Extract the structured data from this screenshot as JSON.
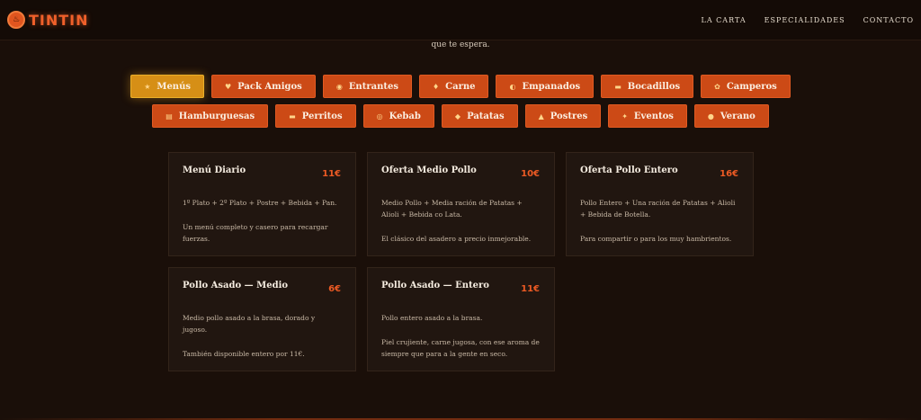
{
  "brand": {
    "name": "TINTIN",
    "logo_icon": "chicken-logo-icon"
  },
  "nav": {
    "items": [
      "LA CARTA",
      "ESPECIALIDADES",
      "CONTACTO"
    ]
  },
  "intro": {
    "text": "que te espera."
  },
  "categories": {
    "row1": [
      {
        "icon": "★",
        "label": "Menús",
        "active": true
      },
      {
        "icon": "♥",
        "label": "Pack Amigos"
      },
      {
        "icon": "◉",
        "label": "Entrantes"
      },
      {
        "icon": "♦",
        "label": "Carne"
      },
      {
        "icon": "◐",
        "label": "Empanados"
      },
      {
        "icon": "▬",
        "label": "Bocadillos"
      },
      {
        "icon": "✿",
        "label": "Camperos"
      }
    ],
    "row2": [
      {
        "icon": "▤",
        "label": "Hamburguesas"
      },
      {
        "icon": "▬",
        "label": "Perritos"
      },
      {
        "icon": "◎",
        "label": "Kebab"
      },
      {
        "icon": "◆",
        "label": "Patatas"
      },
      {
        "icon": "▲",
        "label": "Postres"
      },
      {
        "icon": "✦",
        "label": "Eventos"
      },
      {
        "icon": "●",
        "label": "Verano"
      }
    ]
  },
  "cards": [
    {
      "title": "Menú Diario",
      "price": "11€",
      "desc": "1º Plato + 2º Plato + Postre + Bebida + Pan.",
      "note": "Un menú completo y casero para recargar fuerzas."
    },
    {
      "title": "Oferta Medio Pollo",
      "price": "10€",
      "desc": "Medio Pollo + Media ración de Patatas + Alioli + Bebida co Lata.",
      "note": "El clásico del asadero a precio inmejorable."
    },
    {
      "title": "Oferta Pollo Entero",
      "price": "16€",
      "desc": "Pollo Entero + Una ración de Patatas + Alioli + Bebida de Botella.",
      "note": "Para compartir o para los muy hambrientos."
    },
    {
      "title": "Pollo Asado — Medio",
      "price": "6€",
      "desc": "Medio pollo asado a la brasa, dorado y jugoso.",
      "note": "También disponible entero por 11€."
    },
    {
      "title": "Pollo Asado — Entero",
      "price": "11€",
      "desc": "Pollo entero asado a la brasa.",
      "note": "Piel crujiente, carne jugosa, con ese aroma de siempre que para a la gente en seco."
    }
  ],
  "colors": {
    "accent": "#cc4a16",
    "active": "#d68f16",
    "price": "#ec5a24",
    "background": "#1a0f09"
  }
}
